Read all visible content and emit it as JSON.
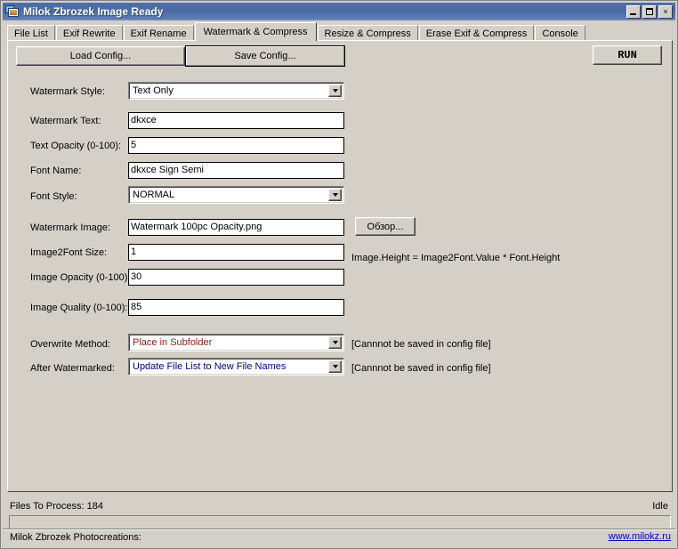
{
  "window": {
    "title": "Milok Zbrozek Image Ready",
    "icon": "image-photo-icon",
    "minimize_label": "Minimize",
    "maximize_label": "Maximize",
    "close_label": "×"
  },
  "tabs": [
    {
      "label": "File List",
      "active": false
    },
    {
      "label": "Exif Rewrite",
      "active": false
    },
    {
      "label": "Exif Rename",
      "active": false
    },
    {
      "label": "Watermark & Compress",
      "active": true
    },
    {
      "label": "Resize  & Compress",
      "active": false
    },
    {
      "label": "Erase Exif & Compress",
      "active": false
    },
    {
      "label": "Console",
      "active": false
    }
  ],
  "toolbar": {
    "load_config": "Load Config...",
    "save_config": "Save Config...",
    "run": "RUN"
  },
  "form": {
    "watermark_style": {
      "label": "Watermark Style:",
      "value": "Text Only"
    },
    "watermark_text": {
      "label": "Watermark Text:",
      "value": "dkxce"
    },
    "text_opacity": {
      "label": "Text Opacity (0-100):",
      "value": "5"
    },
    "font_name": {
      "label": "Font Name:",
      "value": "dkxce Sign Semi"
    },
    "font_style": {
      "label": "Font Style:",
      "value": "NORMAL"
    },
    "watermark_image": {
      "label": "Watermark Image:",
      "value": "Watermark 100pc Opacity.png",
      "browse_label": "Обзор..."
    },
    "image2font_size": {
      "label": "Image2Font Size:",
      "value": "1",
      "hint": "Image.Height = Image2Font.Value * Font.Height"
    },
    "image_opacity": {
      "label": "Image Opacity (0-100):",
      "value": "30"
    },
    "image_quality": {
      "label": "Image Quality (0-100):",
      "value": "85"
    },
    "overwrite_method": {
      "label": "Overwrite Method:",
      "value": "Place in Subfolder",
      "value_color": "#8B1A1A",
      "note": "[Cannnot be saved in config file]"
    },
    "after_watermarked": {
      "label": "After Watermarked:",
      "value": "Update File List to New File Names",
      "value_color": "#000080",
      "note": "[Cannnot be saved in config file]"
    }
  },
  "status": {
    "files_to_process": "Files To Process: 184",
    "state": "Idle",
    "progress_percent": 0
  },
  "footer": {
    "credit": "Milok Zbrozek Photocreations:",
    "link": "www.milokz.ru"
  },
  "colors": {
    "face": "#d4d0c8",
    "titlebar": "#4a6aa5",
    "link": "#0000cc",
    "red_value": "#8B1A1A",
    "navy_value": "#000080"
  }
}
